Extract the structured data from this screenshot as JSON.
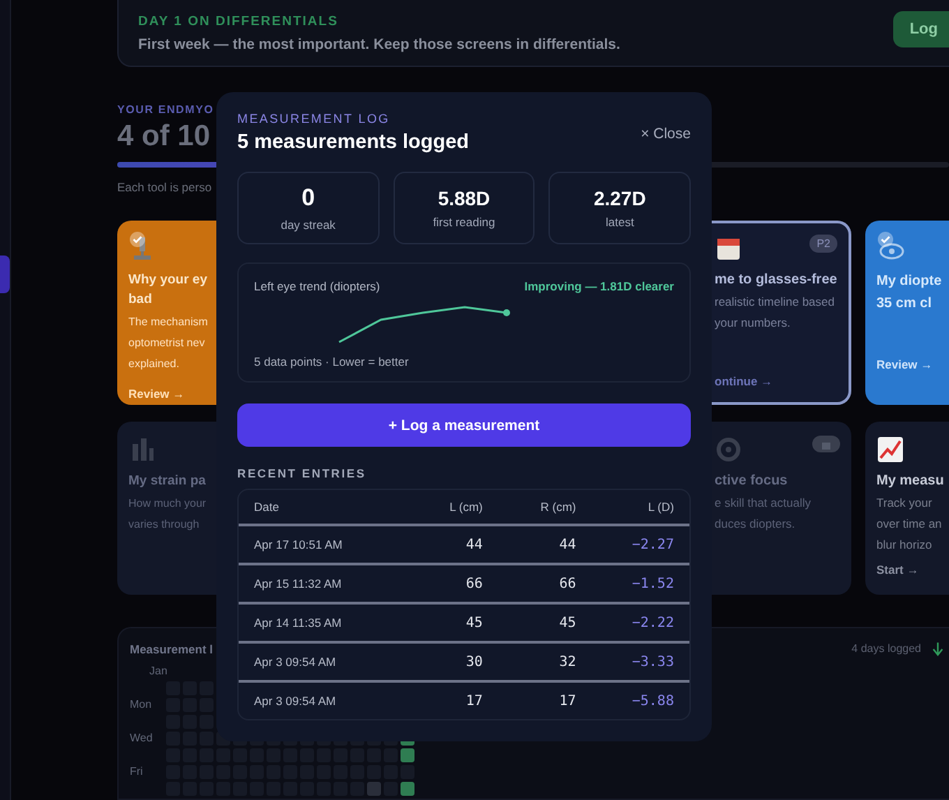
{
  "banner": {
    "eyebrow": "DAY 1 ON DIFFERENTIALS",
    "message": "First week — the most important. Keep those screens in differentials.",
    "button": "Log"
  },
  "progress_section": {
    "eyebrow": "YOUR ENDMYO",
    "heading": "4 of 10",
    "level": 0.4,
    "note": "Each tool is perso"
  },
  "left_cards": [
    {
      "color": "#c9700f",
      "done": true,
      "locked": false,
      "title_lines": [
        "Why your ey",
        "bad"
      ],
      "description_lines": [
        "The mechanism",
        "optometrist nev",
        "explained."
      ],
      "link": "Review →"
    },
    {
      "color": "#131829",
      "done": false,
      "locked": true,
      "title_lines": [
        "My strain pa"
      ],
      "description_lines": [
        "How much your",
        "varies through"
      ]
    }
  ],
  "right_cards": [
    {
      "color": "#141a30",
      "done": false,
      "locked": false,
      "highlighted": true,
      "badge": "P2",
      "title_lines": [
        "me to glasses-free"
      ],
      "description_lines": [
        "realistic timeline based",
        "your numbers."
      ],
      "link": "ontinue →"
    },
    {
      "color": "#2a79cf",
      "done": true,
      "locked": false,
      "highlighted": false,
      "title_lines": [
        "My diopte",
        "35 cm cl"
      ],
      "link": "Review →"
    },
    {
      "color": "#131829",
      "done": false,
      "locked": true,
      "highlighted": false,
      "title_lines": [
        "ctive focus"
      ],
      "description_lines": [
        "e skill that actually",
        "duces diopters."
      ]
    },
    {
      "color": "#131829",
      "done": false,
      "locked": false,
      "highlighted": false,
      "title_lines": [
        "My measu"
      ],
      "description_lines": [
        "Track your",
        "over time an",
        "blur horizo"
      ],
      "link": "Start →"
    }
  ],
  "activity_panel": {
    "title": "Measurement l",
    "summary": "4 days logged",
    "month": "Jan",
    "weekdays": [
      "Mon",
      "Wed",
      "Fri"
    ]
  },
  "modal": {
    "eyebrow": "MEASUREMENT LOG",
    "title": "5 measurements logged",
    "close": "× Close",
    "stats": [
      {
        "value": "0",
        "label": "day streak"
      },
      {
        "value": "5.88D",
        "label": "first reading"
      },
      {
        "value": "2.27D",
        "label": "latest"
      }
    ],
    "trend": {
      "title": "Left eye trend (diopters)",
      "status": "Improving — 1.81D clearer",
      "footnote": "5 data points · Lower = better"
    },
    "action_button": "+ Log a measurement",
    "entries_heading": "RECENT ENTRIES",
    "table": {
      "columns": [
        "Date",
        "L (cm)",
        "R (cm)",
        "L (D)"
      ],
      "rows": [
        [
          "Apr 17 10:51 AM",
          "44",
          "44",
          "−2.27"
        ],
        [
          "Apr 15 11:32 AM",
          "66",
          "66",
          "−1.52"
        ],
        [
          "Apr 14 11:35 AM",
          "45",
          "45",
          "−2.22"
        ],
        [
          "Apr 3 09:54 AM",
          "30",
          "32",
          "−3.33"
        ],
        [
          "Apr 3 09:54 AM",
          "17",
          "17",
          "−5.88"
        ]
      ]
    }
  }
}
